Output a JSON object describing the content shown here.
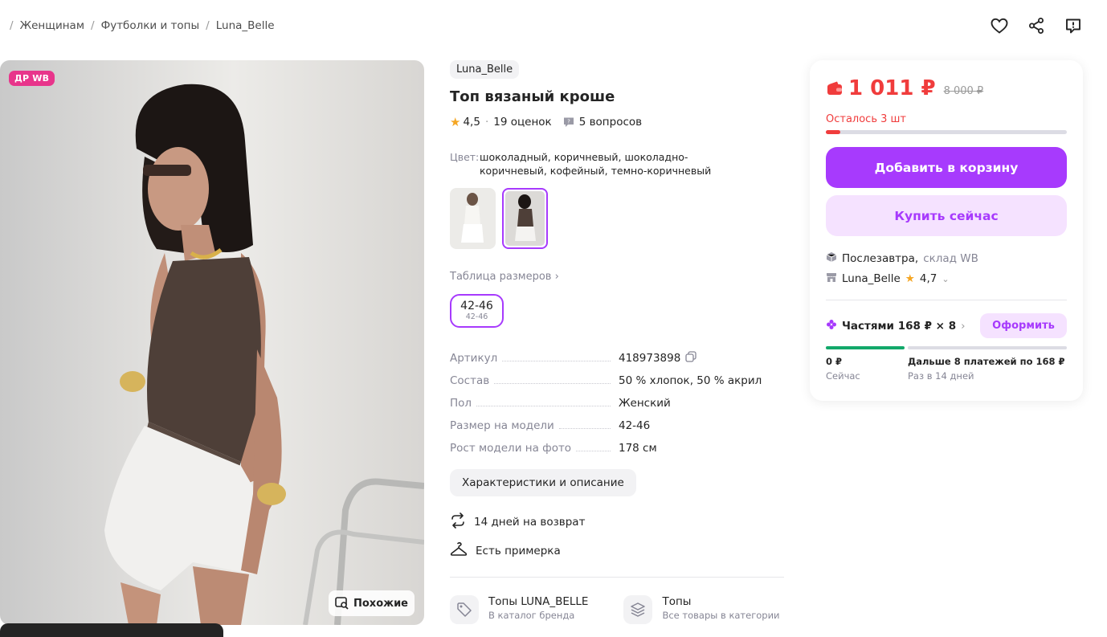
{
  "breadcrumb": {
    "items": [
      "Женщинам",
      "Футболки и топы",
      "Luna_Belle"
    ]
  },
  "top_actions": [
    "heart-icon",
    "share-icon",
    "report-icon"
  ],
  "photo": {
    "badge": "ДР WB",
    "similar_label": "Похожие"
  },
  "product": {
    "brand": "Luna_Belle",
    "title": "Топ вязаный кроше",
    "rating": "4,5",
    "reviews": "19 оценок",
    "questions": "5 вопросов",
    "color_label": "Цвет:",
    "color_value": "шоколадный, коричневый, шоколадно-коричневый, кофейный, темно-коричневый",
    "size_table_label": "Таблица размеров",
    "size": {
      "label": "42-46",
      "sub": "42-46"
    },
    "specs": [
      {
        "key": "Артикул",
        "value": "418973898"
      },
      {
        "key": "Состав",
        "value": "50 % хлопок, 50 % акрил"
      },
      {
        "key": "Пол",
        "value": "Женский"
      },
      {
        "key": "Размер на модели",
        "value": "42-46"
      },
      {
        "key": "Рост модели на фото",
        "value": "178 см"
      }
    ],
    "characteristics_button": "Характеристики и описание",
    "features": [
      {
        "icon": "return-arrows-icon",
        "label": "14 дней на возврат"
      },
      {
        "icon": "hanger-icon",
        "label": "Есть примерка"
      }
    ],
    "categories": [
      {
        "icon": "tag-icon",
        "title": "Топы LUNA_BELLE",
        "subtitle": "В каталог бренда"
      },
      {
        "icon": "layers-icon",
        "title": "Топы",
        "subtitle": "Все товары в категории"
      }
    ]
  },
  "buy_card": {
    "price": "1 011 ₽",
    "old_price": "8 000 ₽",
    "stock_text": "Осталось 3 шт",
    "stock_fraction": 0.06,
    "add_to_cart": "Добавить в корзину",
    "buy_now": "Купить сейчас",
    "delivery_main": "Послезавтра,",
    "delivery_sub": "склад WB",
    "seller_name": "Luna_Belle",
    "seller_rating": "4,7",
    "parts_label": "Частями 168 ₽ × 8",
    "parts_button": "Оформить",
    "parts_now_amount": "0 ₽",
    "parts_now_label": "Сейчас",
    "parts_next_amount": "Дальше 8 платежей по 168 ₽",
    "parts_next_label": "Раз в 14 дней",
    "colors": {
      "accent": "#a73afd",
      "price": "#f03c3c",
      "parts_green": "#12a86a"
    }
  }
}
